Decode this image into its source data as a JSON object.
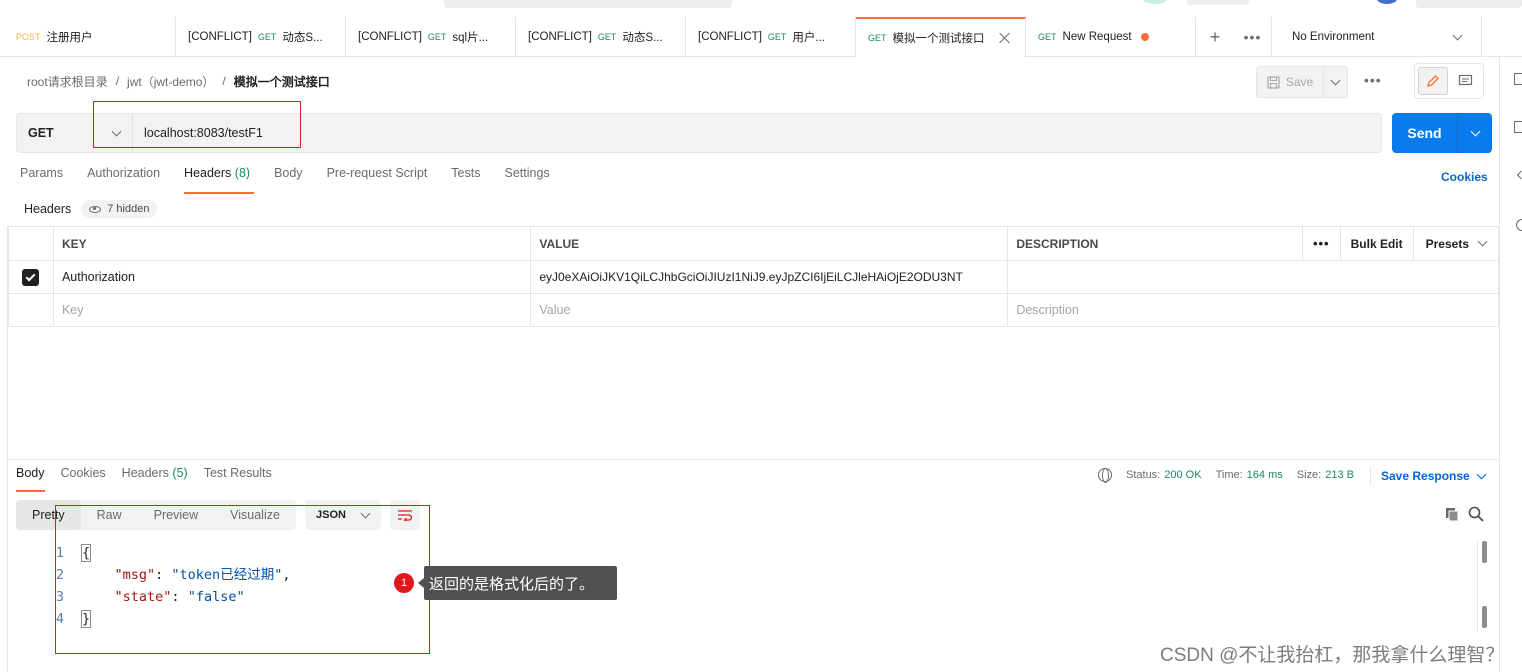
{
  "tabs": [
    {
      "method": "POST",
      "prefix": "",
      "name": "注册用户",
      "active": false
    },
    {
      "method": "GET",
      "prefix": "[CONFLICT]",
      "name": "动态S...",
      "active": false
    },
    {
      "method": "GET",
      "prefix": "[CONFLICT]",
      "name": "sql片...",
      "active": false
    },
    {
      "method": "GET",
      "prefix": "[CONFLICT]",
      "name": "动态S...",
      "active": false
    },
    {
      "method": "GET",
      "prefix": "[CONFLICT]",
      "name": "用户...",
      "active": false
    },
    {
      "method": "GET",
      "prefix": "",
      "name": "模拟一个测试接口",
      "active": true
    },
    {
      "method": "GET",
      "prefix": "",
      "name": "New Request",
      "active": false
    }
  ],
  "tab_controls": {
    "add": "+",
    "more": "•••"
  },
  "environment": {
    "selected": "No Environment"
  },
  "breadcrumb": {
    "root": "root请求根目录",
    "collection": "jwt（jwt-demo）",
    "current": "模拟一个测试接口",
    "separator": "/"
  },
  "toolbar": {
    "save_label": "Save",
    "more": "•••"
  },
  "request": {
    "method": "GET",
    "url": "localhost:8083/testF1",
    "send_label": "Send"
  },
  "request_tabs": [
    {
      "label": "Params",
      "count": ""
    },
    {
      "label": "Authorization",
      "count": ""
    },
    {
      "label": "Headers",
      "count": "(8)"
    },
    {
      "label": "Body",
      "count": ""
    },
    {
      "label": "Pre-request Script",
      "count": ""
    },
    {
      "label": "Tests",
      "count": ""
    },
    {
      "label": "Settings",
      "count": ""
    }
  ],
  "cookies_link": "Cookies",
  "headers_section": {
    "title": "Headers",
    "hidden": "7 hidden"
  },
  "headers_table": {
    "columns": {
      "key": "KEY",
      "value": "VALUE",
      "description": "DESCRIPTION",
      "more": "•••",
      "bulk_edit": "Bulk Edit",
      "presets": "Presets"
    },
    "rows": [
      {
        "checked": true,
        "key": "Authorization",
        "value": "eyJ0eXAiOiJKV1QiLCJhbGciOiJIUzI1NiJ9.eyJpZCI6IjEiLCJleHAiOjE2ODU3NT",
        "description": ""
      }
    ],
    "placeholders": {
      "key": "Key",
      "value": "Value",
      "description": "Description"
    }
  },
  "response_tabs": [
    {
      "label": "Body",
      "count": ""
    },
    {
      "label": "Cookies",
      "count": ""
    },
    {
      "label": "Headers",
      "count": "(5)"
    },
    {
      "label": "Test Results",
      "count": ""
    }
  ],
  "response_status": {
    "status_label": "Status:",
    "status": "200 OK",
    "time_label": "Time:",
    "time": "164 ms",
    "size_label": "Size:",
    "size": "213 B",
    "save_response": "Save Response"
  },
  "view_modes": [
    "Pretty",
    "Raw",
    "Preview",
    "Visualize"
  ],
  "format": "JSON",
  "code_lines": [
    {
      "n": "1",
      "text": "{"
    },
    {
      "n": "2",
      "key": "\"msg\"",
      "colon": ": ",
      "val": "\"token已经过期\"",
      "tail": ","
    },
    {
      "n": "3",
      "key": "\"state\"",
      "colon": ": ",
      "val": "\"false\"",
      "tail": ""
    },
    {
      "n": "4",
      "text": "}"
    }
  ],
  "annotation": {
    "number": "1",
    "text": "返回的是格式化后的了。"
  },
  "watermark": "CSDN @不让我抬杠，那我拿什么理智？",
  "colors": {
    "accent": "#ff6c37",
    "send": "#097bed",
    "get": "#1d8b5e",
    "post": "#e9b73b",
    "annotation_red": "#e0191f"
  }
}
